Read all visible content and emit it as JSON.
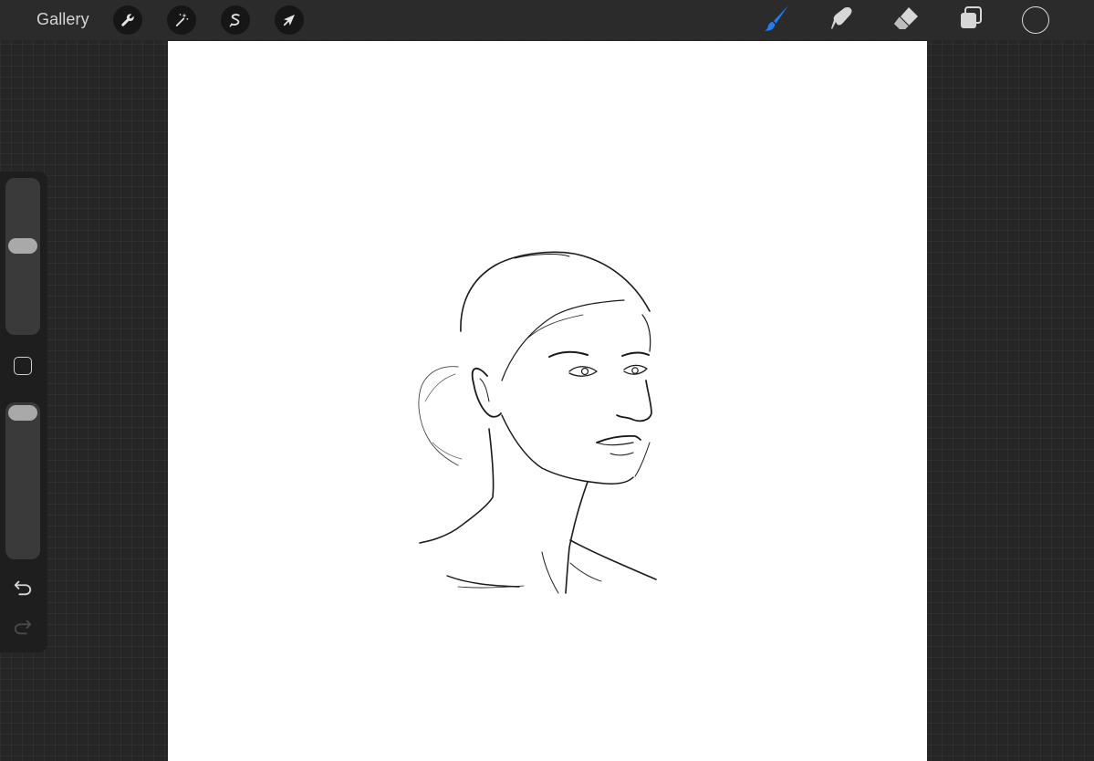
{
  "toolbar": {
    "gallery_label": "Gallery",
    "left_tools": [
      {
        "name": "actions",
        "icon": "wrench-icon"
      },
      {
        "name": "adjustments",
        "icon": "magic-wand-icon"
      },
      {
        "name": "selection",
        "icon": "selection-s-icon"
      },
      {
        "name": "transform",
        "icon": "arrow-cursor-icon"
      }
    ],
    "right_tools": [
      {
        "name": "brush",
        "icon": "brush-icon",
        "active": true
      },
      {
        "name": "smudge",
        "icon": "smudge-finger-icon",
        "active": false
      },
      {
        "name": "eraser",
        "icon": "eraser-icon",
        "active": false
      },
      {
        "name": "layers",
        "icon": "layers-icon",
        "active": false
      },
      {
        "name": "color",
        "icon": "color-swatch",
        "active": false
      }
    ]
  },
  "sidebar": {
    "brush_size_level": 0.42,
    "brush_opacity_level": 0.0,
    "modify_icon": "square-icon",
    "undo_icon": "undo-arrow-icon",
    "redo_icon": "redo-arrow-icon"
  },
  "colors": {
    "accent": "#1f7ff2",
    "background": "#262626",
    "toolbar": "#2b2b2b",
    "canvas": "#ffffff",
    "current_color": "#2b2b2b"
  }
}
